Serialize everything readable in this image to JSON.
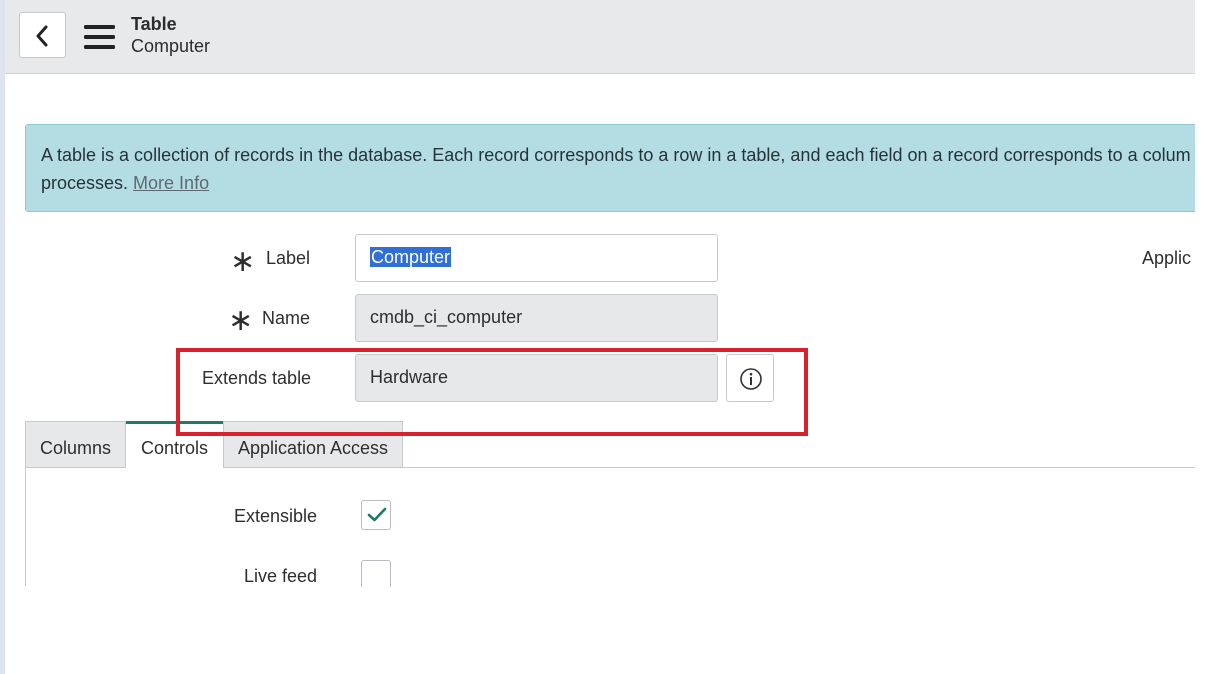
{
  "header": {
    "title": "Table",
    "subtitle": "Computer",
    "back_icon": "chevron-left-icon",
    "menu_icon": "hamburger-icon"
  },
  "banner": {
    "text": "A table is a collection of records in the database. Each record corresponds to a row in a table, and each field on a record corresponds to a colum",
    "text_line2": "processes. ",
    "link": "More Info"
  },
  "form": {
    "label_field": {
      "label": "Label",
      "value": "Computer",
      "required": true
    },
    "name_field": {
      "label": "Name",
      "value": "cmdb_ci_computer",
      "required": true
    },
    "extends_field": {
      "label": "Extends table",
      "value": "Hardware",
      "info_icon": "info-circle-icon"
    },
    "application_label": "Applic"
  },
  "tabs": [
    {
      "label": "Columns",
      "active": false
    },
    {
      "label": "Controls",
      "active": true
    },
    {
      "label": "Application Access",
      "active": false
    }
  ],
  "controls": {
    "extensible": {
      "label": "Extensible",
      "checked": true
    },
    "live_feed": {
      "label": "Live feed",
      "checked": false
    }
  },
  "colors": {
    "banner_bg": "#b3dde3",
    "highlight_border": "#d8232f",
    "accent": "#1f7a6c",
    "selection": "#2f6fd6"
  }
}
